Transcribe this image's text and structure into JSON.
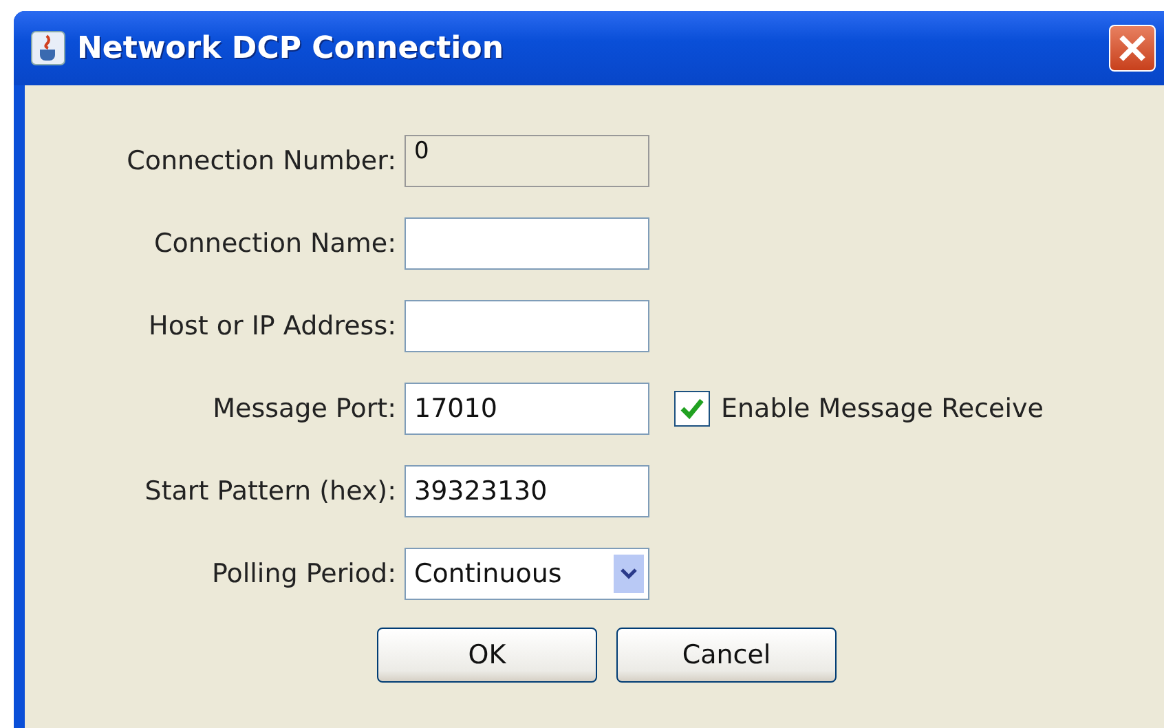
{
  "window": {
    "title": "Network DCP Connection"
  },
  "fields": [
    {
      "kind": "text",
      "label": "Connection Number:",
      "value": "0",
      "disabled": true
    },
    {
      "kind": "text",
      "label": "Connection Name:",
      "disabled": false
    },
    {
      "kind": "text",
      "label": "Host or IP Address:",
      "disabled": false
    },
    {
      "kind": "text",
      "label": "Message Port:",
      "value": "17010",
      "disabled": false,
      "checkbox": {
        "label": "Enable Message Receive",
        "checked": true
      }
    },
    {
      "kind": "text",
      "label": "Start Pattern (hex):",
      "value": "39323130",
      "disabled": false
    },
    {
      "kind": "select",
      "label": "Polling Period:",
      "value": "Continuous",
      "disabled": false
    }
  ],
  "buttons": [
    "OK",
    "Cancel"
  ]
}
